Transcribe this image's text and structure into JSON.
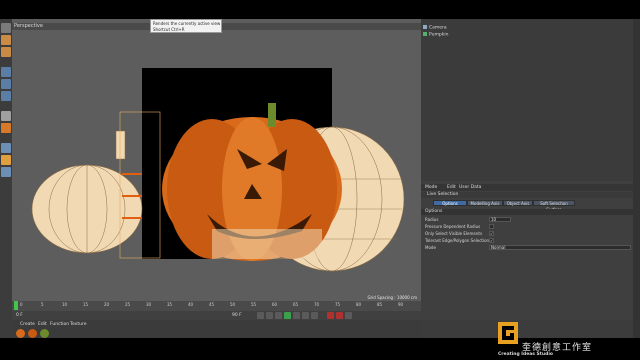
{
  "viewport": {
    "label": "Perspective",
    "tooltip_line1": "Renders the currently active view",
    "tooltip_line2": "Shortcut Ctrl+R",
    "grid_status": "Grid Spacing : 10000 cm"
  },
  "object_manager": {
    "items": [
      {
        "label": "Camera",
        "icon": "camera-icon"
      },
      {
        "label": "Pumpkin",
        "icon": "null-object-icon"
      }
    ]
  },
  "attribute_manager": {
    "menu": [
      "Mode",
      "Edit",
      "User Data"
    ],
    "mode_title": "Live Selection",
    "tabs": [
      "Options",
      "Modelling Axis",
      "Object Axis",
      "Soft Selection Surface"
    ],
    "active_tab": "Options",
    "section": "Options",
    "options": [
      {
        "label": "Radius",
        "value": "10"
      },
      {
        "label": "Pressure Dependent Radius",
        "checked": false
      },
      {
        "label": "Only Select Visible Elements",
        "checked": true
      },
      {
        "label": "Tolerant Edge/Polygon Selection",
        "checked": true
      },
      {
        "label": "Mode",
        "value": "Normal"
      }
    ]
  },
  "timeline": {
    "ticks": [
      "0",
      "5",
      "10",
      "15",
      "20",
      "25",
      "30",
      "35",
      "40",
      "45",
      "50",
      "55",
      "60",
      "65",
      "70",
      "75",
      "80",
      "85",
      "90"
    ],
    "start_frame": "0 F",
    "end_frame": "90 F"
  },
  "material_manager": {
    "menu": [
      "Create",
      "Edit",
      "Function",
      "Texture"
    ]
  },
  "watermark": {
    "studio_cn": "奎德創意工作室",
    "studio_en": "Creating Ideas Studio"
  },
  "colors": {
    "viewport_bg": "#5d5d5d",
    "panel_bg": "#3b3b3b",
    "accent_blue": "#3f6aa3",
    "pumpkin_orange": "#d86a1a",
    "pumpkin_wire": "#f1d9b3"
  }
}
